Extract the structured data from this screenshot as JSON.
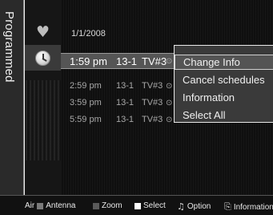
{
  "side_tab": {
    "label": "Programmed"
  },
  "icons": [
    "heart-icon",
    "clock-icon"
  ],
  "list": {
    "date": "1/1/2008",
    "rows": [
      {
        "time": "1:59 pm",
        "channel": "13-1",
        "program": "TV#3",
        "marker": "⊙",
        "active": true
      },
      {
        "time": "2:59 pm",
        "channel": "13-1",
        "program": "TV#3",
        "marker": "⊙",
        "active": false
      },
      {
        "time": "3:59 pm",
        "channel": "13-1",
        "program": "TV#3",
        "marker": "⊙",
        "active": false
      },
      {
        "time": "5:59 pm",
        "channel": "13-1",
        "program": "TV#3",
        "marker": "⊙",
        "active": false
      }
    ]
  },
  "menu": {
    "items": [
      "Change Info",
      "Cancel schedules",
      "Information",
      "Select All"
    ],
    "selected_index": 0
  },
  "bottom_bar": {
    "air": "Air",
    "antenna": "Antenna",
    "zoom": "Zoom",
    "select": "Select",
    "option": "Option",
    "information": "Information"
  }
}
